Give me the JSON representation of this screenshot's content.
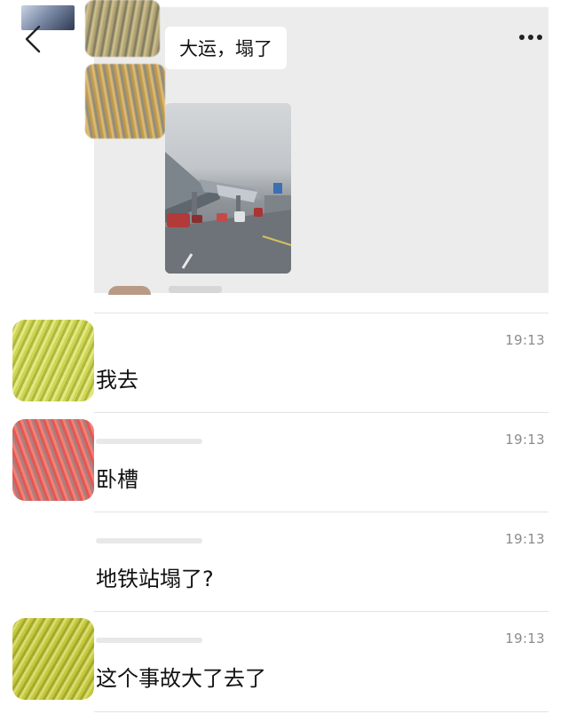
{
  "quoted_chat": {
    "bubble_text": "大运，塌了",
    "photo_description_icon": "photo-thumbnail-icon",
    "back_icon": "chevron-left-icon",
    "more_icon": "more-dots-icon"
  },
  "messages": [
    {
      "time": "19:13",
      "text": "我去"
    },
    {
      "time": "19:13",
      "text": "卧槽"
    },
    {
      "time": "19:13",
      "text": "地铁站塌了?"
    },
    {
      "time": "19:13",
      "text": "这个事故大了去了"
    }
  ]
}
